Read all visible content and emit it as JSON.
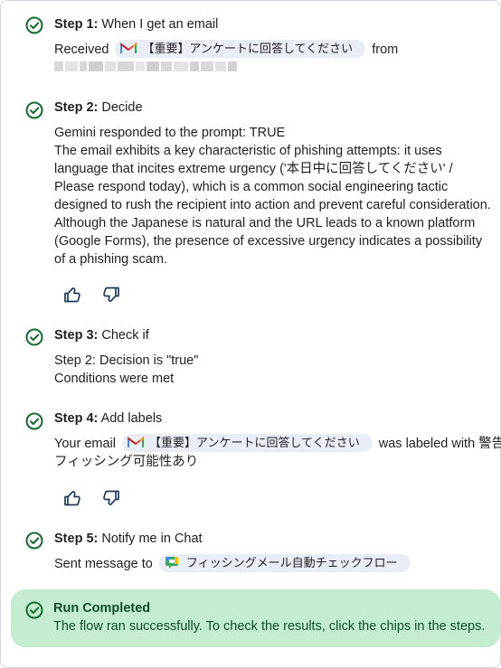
{
  "steps": {
    "s1": {
      "label": "Step 1:",
      "title": " When I get an email",
      "prefix": "Received",
      "chip": "【重要】アンケートに回答してください",
      "suffix": "from"
    },
    "s2": {
      "label": "Step 2:",
      "title": " Decide",
      "response": "Gemini responded to the prompt: TRUE",
      "body": "The email exhibits a key characteristic of phishing attempts: it uses language that incites extreme urgency ('本日中に回答してください' / Please respond today), which is a common social engineering tactic designed to rush the recipient into action and prevent careful consideration. Although the Japanese is natural and the URL leads to a known platform (Google Forms), the presence of excessive urgency indicates a possibility of a phishing scam."
    },
    "s3": {
      "label": "Step 3:",
      "title": " Check if",
      "line1": "Step 2: Decision is \"true\"",
      "line2": "Conditions were met"
    },
    "s4": {
      "label": "Step 4:",
      "title": " Add labels",
      "prefix": "Your email",
      "chip": "【重要】アンケートに回答してください",
      "suffix": "was labeled with 警告:",
      "line2": "フィッシング可能性あり"
    },
    "s5": {
      "label": "Step 5:",
      "title": " Notify me in Chat",
      "prefix": "Sent message to",
      "chip": "フィッシングメール自動チェックフロー"
    }
  },
  "completed": {
    "title": "Run Completed",
    "message": "The flow ran successfully. To check the results, click the chips in the steps."
  },
  "colors": {
    "accent_green": "#146c2e",
    "success_bg": "#c4ecd0",
    "chip_bg": "#e9eef6"
  },
  "icons": [
    "check-circle-icon",
    "gmail-icon",
    "google-chat-icon",
    "thumbs-up-icon",
    "thumbs-down-icon"
  ]
}
